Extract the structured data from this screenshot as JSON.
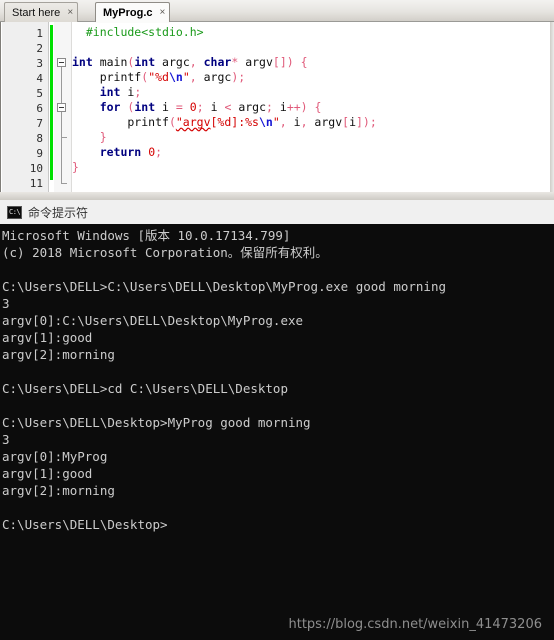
{
  "editor": {
    "tabs": [
      {
        "label": "Start here",
        "close": "×",
        "active": false
      },
      {
        "label": "MyProg.c",
        "close": "×",
        "active": true
      }
    ],
    "line_numbers": [
      "1",
      "2",
      "3",
      "4",
      "5",
      "6",
      "7",
      "8",
      "9",
      "10",
      "11"
    ],
    "code_lines": [
      "#include<stdio.h>",
      "",
      "int main(int argc, char* argv[]) {",
      "    printf(\"%d\\n\", argc);",
      "    int i;",
      "    for (int i = 0; i < argc; i++) {",
      "        printf(\"argv[%d]:%s\\n\", i, argv[i]);",
      "    }",
      "    return 0;",
      "}",
      ""
    ],
    "colors": {
      "preprocessor": "#1a9a1a",
      "keyword": "#00007f",
      "string": "#d40000",
      "escape": "#1515d4",
      "number": "#d40000",
      "operator": "#e05a7a",
      "change_bar": "#00e000",
      "background": "#ffffff",
      "gutter": "#efefef"
    }
  },
  "console": {
    "title": "命令提示符",
    "icon": "cmd-icon",
    "background": "#0c0c0c",
    "text_color": "#cccccc",
    "lines": [
      "Microsoft Windows [版本 10.0.17134.799]",
      "(c) 2018 Microsoft Corporation。保留所有权利。",
      "",
      "C:\\Users\\DELL>C:\\Users\\DELL\\Desktop\\MyProg.exe good morning",
      "3",
      "argv[0]:C:\\Users\\DELL\\Desktop\\MyProg.exe",
      "argv[1]:good",
      "argv[2]:morning",
      "",
      "C:\\Users\\DELL>cd C:\\Users\\DELL\\Desktop",
      "",
      "C:\\Users\\DELL\\Desktop>MyProg good morning",
      "3",
      "argv[0]:MyProg",
      "argv[1]:good",
      "argv[2]:morning",
      "",
      "C:\\Users\\DELL\\Desktop>"
    ]
  },
  "watermark": {
    "text": "https://blog.csdn.net/weixin_41473206"
  }
}
